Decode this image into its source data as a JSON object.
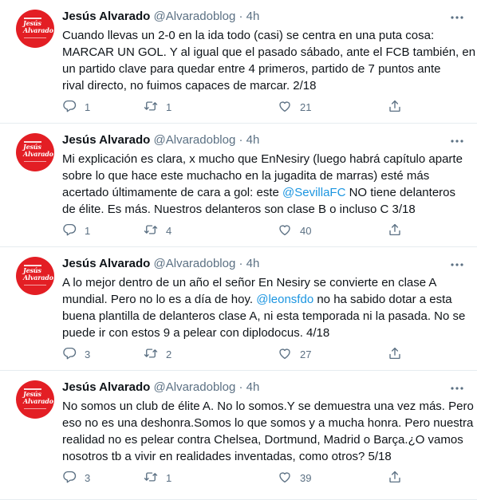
{
  "author": {
    "name": "Jesús Alvarado",
    "handle": "@Alvaradoblog",
    "avatar_text": [
      "Jesús",
      "Alvarado"
    ]
  },
  "separator": "·",
  "colors": {
    "link": "#1b95e0",
    "secondary": "#5b7083",
    "avatar_bg": "#e31e24"
  },
  "icons": [
    "more-icon",
    "reply-icon",
    "retweet-icon",
    "like-icon",
    "share-icon"
  ],
  "tweets": [
    {
      "time": "4h",
      "lines": [
        [
          {
            "t": "Cuando llevas un 2-0 en la ida todo (casi) se centra en una puta cosa:"
          }
        ],
        [
          {
            "t": "MARCAR UN GOL. Y al igual que el pasado sábado, ante el FCB también, en"
          }
        ],
        [
          {
            "t": "un partido clave para quedar entre 4 primeros, partido de 7 puntos ante"
          }
        ],
        [
          {
            "t": "rival directo, no fuimos capaces de marcar. 2/18"
          }
        ]
      ],
      "replies": "1",
      "retweets": "1",
      "likes": "21"
    },
    {
      "time": "4h",
      "lines": [
        [
          {
            "t": "Mi explicación es clara, x mucho que EnNesiry (luego habrá capítulo aparte"
          }
        ],
        [
          {
            "t": "sobre lo que hace este muchacho en la jugadita de marras) esté más"
          }
        ],
        [
          {
            "t": "acertado últimamente de cara a gol: este "
          },
          {
            "t": "@SevillaFC",
            "m": true
          },
          {
            "t": " NO tiene delanteros"
          }
        ],
        [
          {
            "t": "de élite. Es más. Nuestros delanteros son clase B o incluso C 3/18"
          }
        ]
      ],
      "replies": "1",
      "retweets": "4",
      "likes": "40"
    },
    {
      "time": "4h",
      "lines": [
        [
          {
            "t": "A lo mejor dentro de un año el señor En Nesiry se convierte en clase A"
          }
        ],
        [
          {
            "t": "mundial. Pero no lo es a día de hoy. "
          },
          {
            "t": "@leonsfdo",
            "m": true
          },
          {
            "t": " no ha sabido dotar a esta"
          }
        ],
        [
          {
            "t": "buena plantilla de delanteros clase A, ni esta temporada ni la pasada. No se"
          }
        ],
        [
          {
            "t": "puede ir con estos 9 a pelear con diplodocus. 4/18"
          }
        ]
      ],
      "replies": "3",
      "retweets": "2",
      "likes": "27"
    },
    {
      "time": "4h",
      "lines": [
        [
          {
            "t": "No somos un club de élite A. No lo somos.Y se demuestra una vez más. Pero"
          }
        ],
        [
          {
            "t": "eso no es una deshonra.Somos lo que somos y a mucha honra. Pero nuestra"
          }
        ],
        [
          {
            "t": "realidad no es pelear contra Chelsea, Dortmund, Madrid o Barça.¿O vamos"
          }
        ],
        [
          {
            "t": "nosotros tb a vivir en realidades inventadas, como otros? 5/18"
          }
        ]
      ],
      "replies": "3",
      "retweets": "1",
      "likes": "39"
    }
  ]
}
